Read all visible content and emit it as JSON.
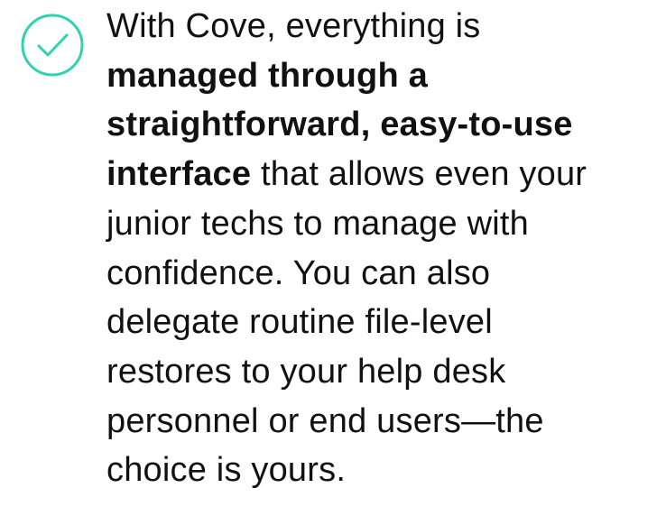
{
  "feature": {
    "icon": "check-circle-icon",
    "accent_color": "#2fd3b1",
    "text_color": "#111111",
    "lines": [
      {
        "plain": "With Cove, everything is"
      },
      {
        "bold": "managed through a"
      },
      {
        "bold": "straightforward, easy-to-use"
      },
      {
        "bold": "interface",
        "plain": " that allows even your"
      },
      {
        "plain": "junior techs to manage with"
      },
      {
        "plain": "confidence. You can also"
      },
      {
        "plain": "delegate routine file-level"
      },
      {
        "plain": "restores to your help desk"
      },
      {
        "plain": "personnel or end users—the"
      },
      {
        "plain": "choice is yours."
      }
    ]
  }
}
